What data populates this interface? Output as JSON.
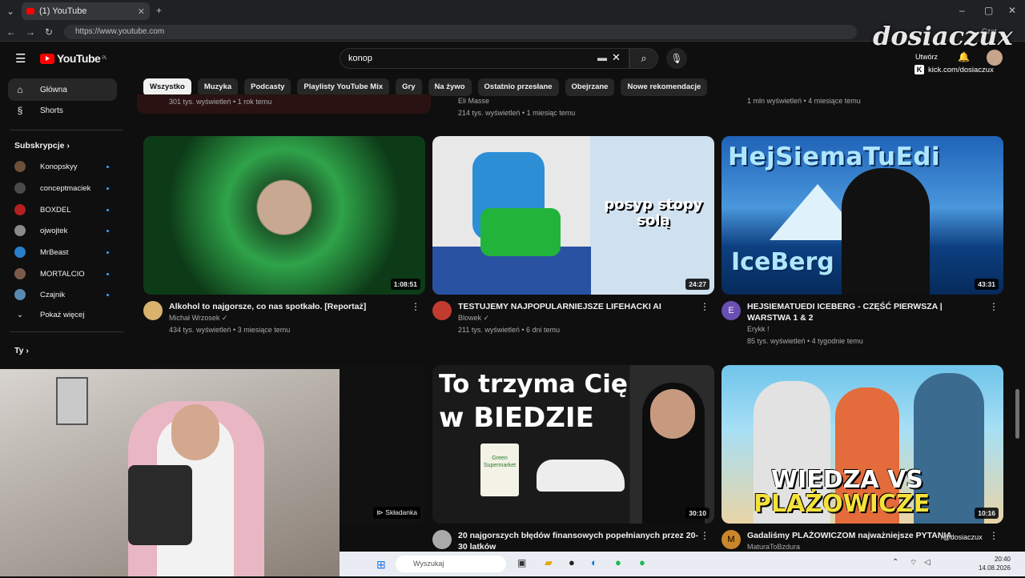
{
  "browser": {
    "tab_title": "(1) YouTube",
    "url": "https://www.youtube.com",
    "chat_label": "Czat"
  },
  "header": {
    "logo_text": "YouTube",
    "logo_region": "PL",
    "search_value": "konop",
    "create_label": "Utwórz"
  },
  "chips": [
    "Wszystko",
    "Muzyka",
    "Podcasty",
    "Playlisty YouTube Mix",
    "Gry",
    "Na żywo",
    "Ostatnio przesłane",
    "Obejrzane",
    "Nowe rekomendacje"
  ],
  "sidebar": {
    "home": "Główna",
    "shorts": "Shorts",
    "subscriptions_title": "Subskrypcje",
    "subscriptions": [
      {
        "name": "Konopskyy",
        "color": "#6b4f3a"
      },
      {
        "name": "conceptmaciek",
        "color": "#4a4a4a"
      },
      {
        "name": "BOXDEL",
        "color": "#b32020"
      },
      {
        "name": "ojwojtek",
        "color": "#8a8a8a"
      },
      {
        "name": "MrBeast",
        "color": "#2a7fc9"
      },
      {
        "name": "MORTALCIO",
        "color": "#7b5a4a"
      },
      {
        "name": "Czajnik",
        "color": "#5a8ab0"
      }
    ],
    "show_more": "Pokaż więcej",
    "you_title": "Ty"
  },
  "partial_row": {
    "stats_left": "301 tys. wyświetleń • 1 rok temu",
    "channel_mid": "Eli Masse",
    "stats_mid": "214 tys. wyświetleń • 1 miesiąc temu",
    "stats_right": "1 mln wyświetleń • 4 miesiące temu"
  },
  "videos": [
    {
      "title": "Alkohol to najgorsze, co nas spotkało. [Reportaż]",
      "channel": "Michał Wrzosek ✓",
      "stats": "434 tys. wyświetleń • 3 miesiące temu",
      "duration": "1:08:51",
      "avatar_color": "#d9b36c"
    },
    {
      "title": "TESTUJEMY NAJPOPULARNIEJSZE LIFEHACKI AI",
      "channel": "Blowek ✓",
      "stats": "211 tys. wyświetleń • 6 dni temu",
      "duration": "24:27",
      "avatar_color": "#c23b2f",
      "overlay": "posyp stopy solą"
    },
    {
      "title": "HEJSIEMATUEDI ICEBERG - CZĘŚĆ PIERWSZA | WARSTWA 1 & 2",
      "channel": "Erykk !",
      "stats": "85 tys. wyświetleń • 4 tygodnie temu",
      "duration": "43:31",
      "avatar_color": "#6a4fb3",
      "avatar_letter": "E",
      "overlay_top": "HejSiemaTuEdi",
      "overlay_bottom": "IceBerg"
    },
    {
      "title": "",
      "duration": "",
      "badge": "Składanka"
    },
    {
      "title": "20 najgorszych błędów finansowych popełnianych przez 20-30 latków",
      "channel": "",
      "stats": "",
      "duration": "30:10",
      "avatar_color": "#aaaaaa",
      "overlay_1": "To trzyma Cię",
      "overlay_2": "w BIEDZIE",
      "overlay_small": "Green Supermarket"
    },
    {
      "title": "Gadaliśmy PLAŻOWICZOM najważniejsze PYTANIA",
      "channel": "MaturaToBzdura",
      "stats": "",
      "duration": "10:16",
      "avatar_color": "#c9862b",
      "avatar_letter": "M",
      "overlay_1": "WIEDZA VS",
      "overlay_2": "PLAŻOWICZE"
    }
  ],
  "stream_overlay": {
    "brand": "dosiaczux",
    "kick": "kick.com/dosiaczux",
    "handle": "/@dosiaczux"
  },
  "taskbar": {
    "search_placeholder": "Wyszukaj",
    "time": "20:40",
    "date": "14.08.2026"
  }
}
